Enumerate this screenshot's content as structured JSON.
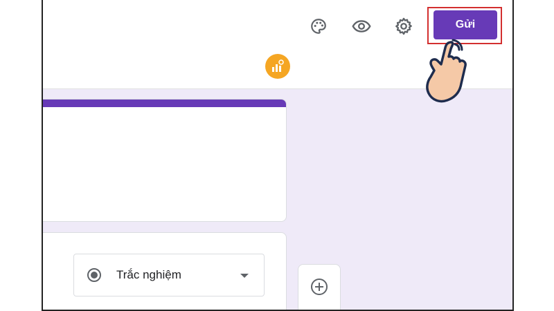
{
  "toolbar": {
    "send_label": "Gửi",
    "icons": [
      "palette-icon",
      "preview-eye-icon",
      "settings-gear-icon"
    ]
  },
  "question": {
    "type_value": "Trắc nghiệm"
  },
  "colors": {
    "accent": "#673ab7",
    "canvas_bg": "#efeaf8",
    "highlight": "#d32f2f",
    "watermark": "#f5a623",
    "hand_fill": "#f5c9a7"
  }
}
